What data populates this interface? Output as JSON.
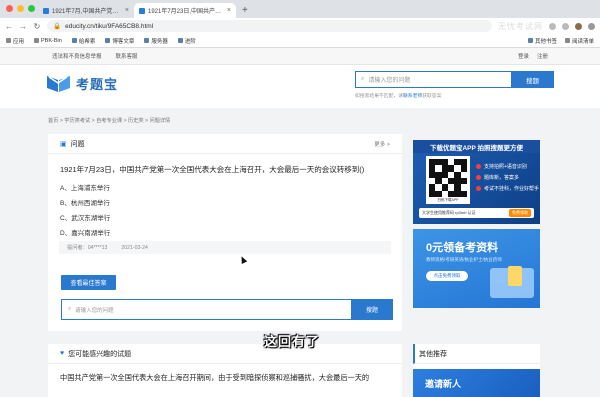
{
  "browser": {
    "tabs": [
      {
        "label": "1921年7月,中国共产党第一次全国代",
        "active": false
      },
      {
        "label": "1921年7月23日,中国共产党第一次全",
        "active": true
      }
    ],
    "url": "educity.cn/tiku/9FA65CB8.html",
    "bookmarks": [
      "应用",
      "PBK-Bin",
      "给希索",
      "博客文章",
      "服务器",
      "进阶"
    ],
    "bookmarks_right": [
      "其他书签",
      "阅读清单"
    ],
    "watermark": "无忧考试网"
  },
  "site": {
    "top_links": [
      "违法和不良信息举报",
      "联系客服"
    ],
    "account": [
      "登录",
      "注册"
    ],
    "logo_text": "考题宝",
    "search_placeholder": "请输入您的问题",
    "search_button": "搜题",
    "search_hint_prefix": "如搜索结果不匹配，请",
    "search_hint_link": "联系老师",
    "search_hint_suffix": "获取答案",
    "breadcrumb": "首页 > 学历类考试 > 自考专业课 > 历史类 > 问题详情"
  },
  "question": {
    "section_title": "问题",
    "more": "更多 >",
    "text": "1921年7月23日，中国共产党第一次全国代表大会在上海召开，大会最后一天的会议转移到()",
    "options": [
      "A、上海浦东举行",
      "B、杭州西湖举行",
      "C、武汉东湖举行",
      "D、嘉兴南湖举行"
    ],
    "asker": "提问者：04****13",
    "date": "2021-03-24",
    "best_answer_button": "查看最佳答案",
    "bottom_search_placeholder": "请输入您的问题",
    "bottom_search_button": "搜题"
  },
  "ads": {
    "app_title": "下载优题宝APP 拍照搜题更方便",
    "qr_caption": "扫码下载APP",
    "features": [
      "支持拍照+语音识别",
      "题库新，答案多",
      "考试不挂科，作业好帮手"
    ],
    "code_text": "大学生使用推荐码 rp3mb 认证",
    "code_button": "免费领取",
    "promo_big": "0元领备考资料",
    "promo_sub": "教师资格/考研英语/执业护士/执业药师",
    "promo_button": "点击免费领取"
  },
  "lower": {
    "interest_title": "您可能感兴趣的试题",
    "interest_text": "中国共产党第一次全国代表大会在上海召开期间，由于受到暗探侦察和巡捕骚扰，大会最后一天的",
    "recommend_title": "其他推荐",
    "recommend_ad": "邀请新人"
  },
  "overlay_subtitle": "这回有了",
  "colors": {
    "accent": "#2a79cf"
  }
}
